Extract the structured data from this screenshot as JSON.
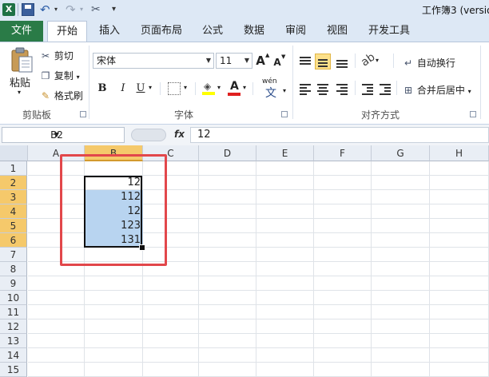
{
  "window": {
    "title": "工作簿3 (versio"
  },
  "quick_access": {
    "icons": [
      "excel-logo-icon",
      "save-icon",
      "undo-icon",
      "redo-icon",
      "tools-icon",
      "customize-icon"
    ],
    "logo_letter": "X"
  },
  "tabs": [
    {
      "label": "文件"
    },
    {
      "label": "开始"
    },
    {
      "label": "插入"
    },
    {
      "label": "页面布局"
    },
    {
      "label": "公式"
    },
    {
      "label": "数据"
    },
    {
      "label": "审阅"
    },
    {
      "label": "视图"
    },
    {
      "label": "开发工具"
    }
  ],
  "ribbon": {
    "clipboard": {
      "paste": "粘贴",
      "cut": "剪切",
      "copy": "复制",
      "format_painter": "格式刷",
      "group_label": "剪贴板"
    },
    "font": {
      "font_name": "宋体",
      "font_size": "11",
      "grow": "A",
      "shrink": "A",
      "bold": "B",
      "italic": "I",
      "underline": "U",
      "font_color_letter": "A",
      "wen": "wén",
      "wen_char": "文",
      "group_label": "字体"
    },
    "alignment": {
      "wrap_text": "自动换行",
      "merge_center": "合并后居中",
      "group_label": "对齐方式"
    }
  },
  "colors": {
    "file_tab": "#2a7b47",
    "selection_fill": "#b8d4f0",
    "highlight_box": "#e2474b",
    "active_header": "#f5c96b"
  },
  "formula_bar": {
    "name_box": "B2",
    "fx": "fx",
    "value": "12"
  },
  "sheet": {
    "columns": [
      "A",
      "B",
      "C",
      "D",
      "E",
      "F",
      "G",
      "H"
    ],
    "rows": [
      "1",
      "2",
      "3",
      "4",
      "5",
      "6",
      "7",
      "8",
      "9",
      "10",
      "11",
      "12",
      "13",
      "14",
      "15"
    ],
    "active_column": "B",
    "cells": [
      {
        "ref": "B2",
        "value": "12"
      },
      {
        "ref": "B3",
        "value": "112"
      },
      {
        "ref": "B4",
        "value": "12"
      },
      {
        "ref": "B5",
        "value": "123"
      },
      {
        "ref": "B6",
        "value": "131"
      }
    ]
  }
}
